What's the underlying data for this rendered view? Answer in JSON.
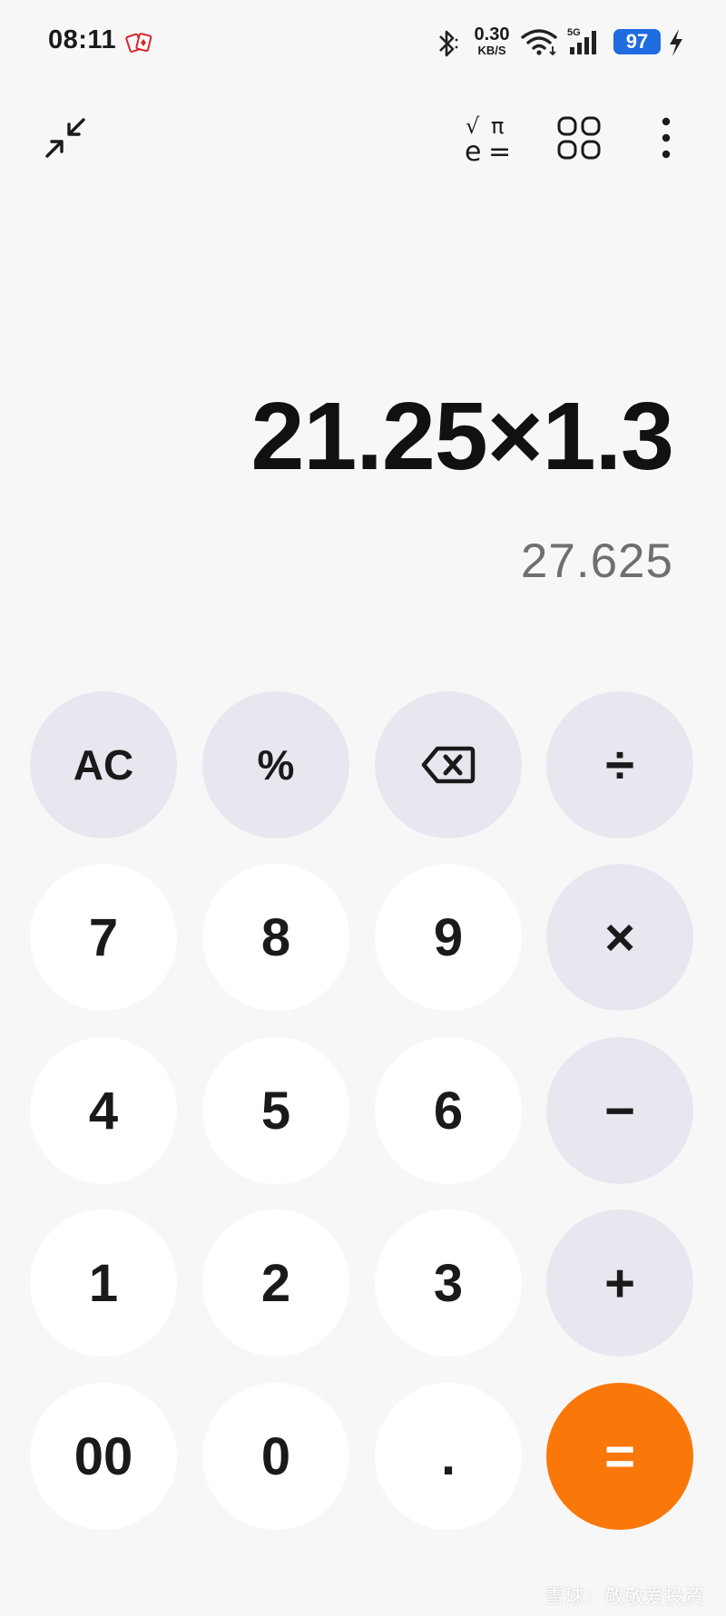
{
  "status_bar": {
    "time": "08:11",
    "net_speed_value": "0.30",
    "net_speed_unit": "KB/S",
    "signal_label": "5G",
    "battery": "97"
  },
  "toolbar": {
    "collapse_icon": "collapse-arrows-icon",
    "scientific_icon": "scientific-mode-icon",
    "scientific_symbols": {
      "sqrt": "√",
      "pi": "π",
      "e": "e",
      "eq": "="
    },
    "layout_icon": "grid-icon",
    "more_icon": "more-vertical-icon"
  },
  "display": {
    "expression": "21.25×1.3",
    "result": "27.625"
  },
  "keys": {
    "ac": "AC",
    "percent": "%",
    "divide": "÷",
    "multiply": "×",
    "minus": "−",
    "plus": "+",
    "equals": "=",
    "k7": "7",
    "k8": "8",
    "k9": "9",
    "k4": "4",
    "k5": "5",
    "k6": "6",
    "k1": "1",
    "k2": "2",
    "k3": "3",
    "k00": "00",
    "k0": "0",
    "dot": "."
  },
  "colors": {
    "background": "#f8f7f8",
    "number_key": "#ffffff",
    "function_key": "#e8e7ef",
    "equals_key": "#fa7709",
    "battery": "#1f6be0"
  },
  "watermark": "雪球：敬敬爱投资"
}
